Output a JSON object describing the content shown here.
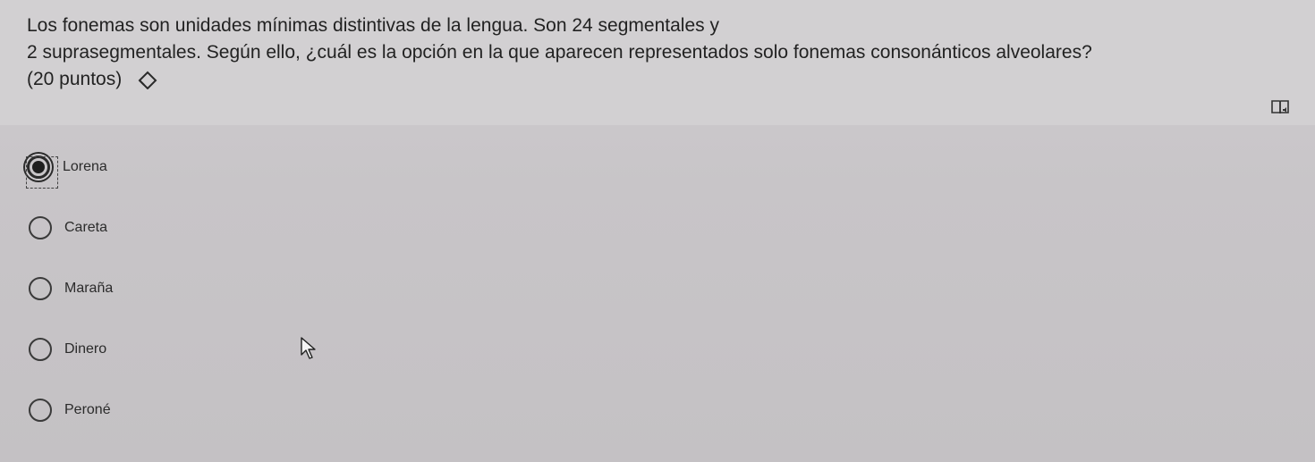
{
  "question": {
    "line1": "Los fonemas son unidades mínimas distintivas de la lengua. Son 24 segmentales y",
    "line2": "2 suprasegmentales. Según ello, ¿cuál es la opción en la que aparecen representados solo fonemas consonánticos alveolares?",
    "points": "(20 puntos)"
  },
  "options": [
    {
      "label": "Lorena",
      "selected": true
    },
    {
      "label": "Careta",
      "selected": false
    },
    {
      "label": "Maraña",
      "selected": false
    },
    {
      "label": "Dinero",
      "selected": false
    },
    {
      "label": "Peroné",
      "selected": false
    }
  ],
  "icons": {
    "edit": "pencil-eraser-icon",
    "reader": "immersive-reader-icon",
    "cursor": "mouse-pointer-icon"
  }
}
